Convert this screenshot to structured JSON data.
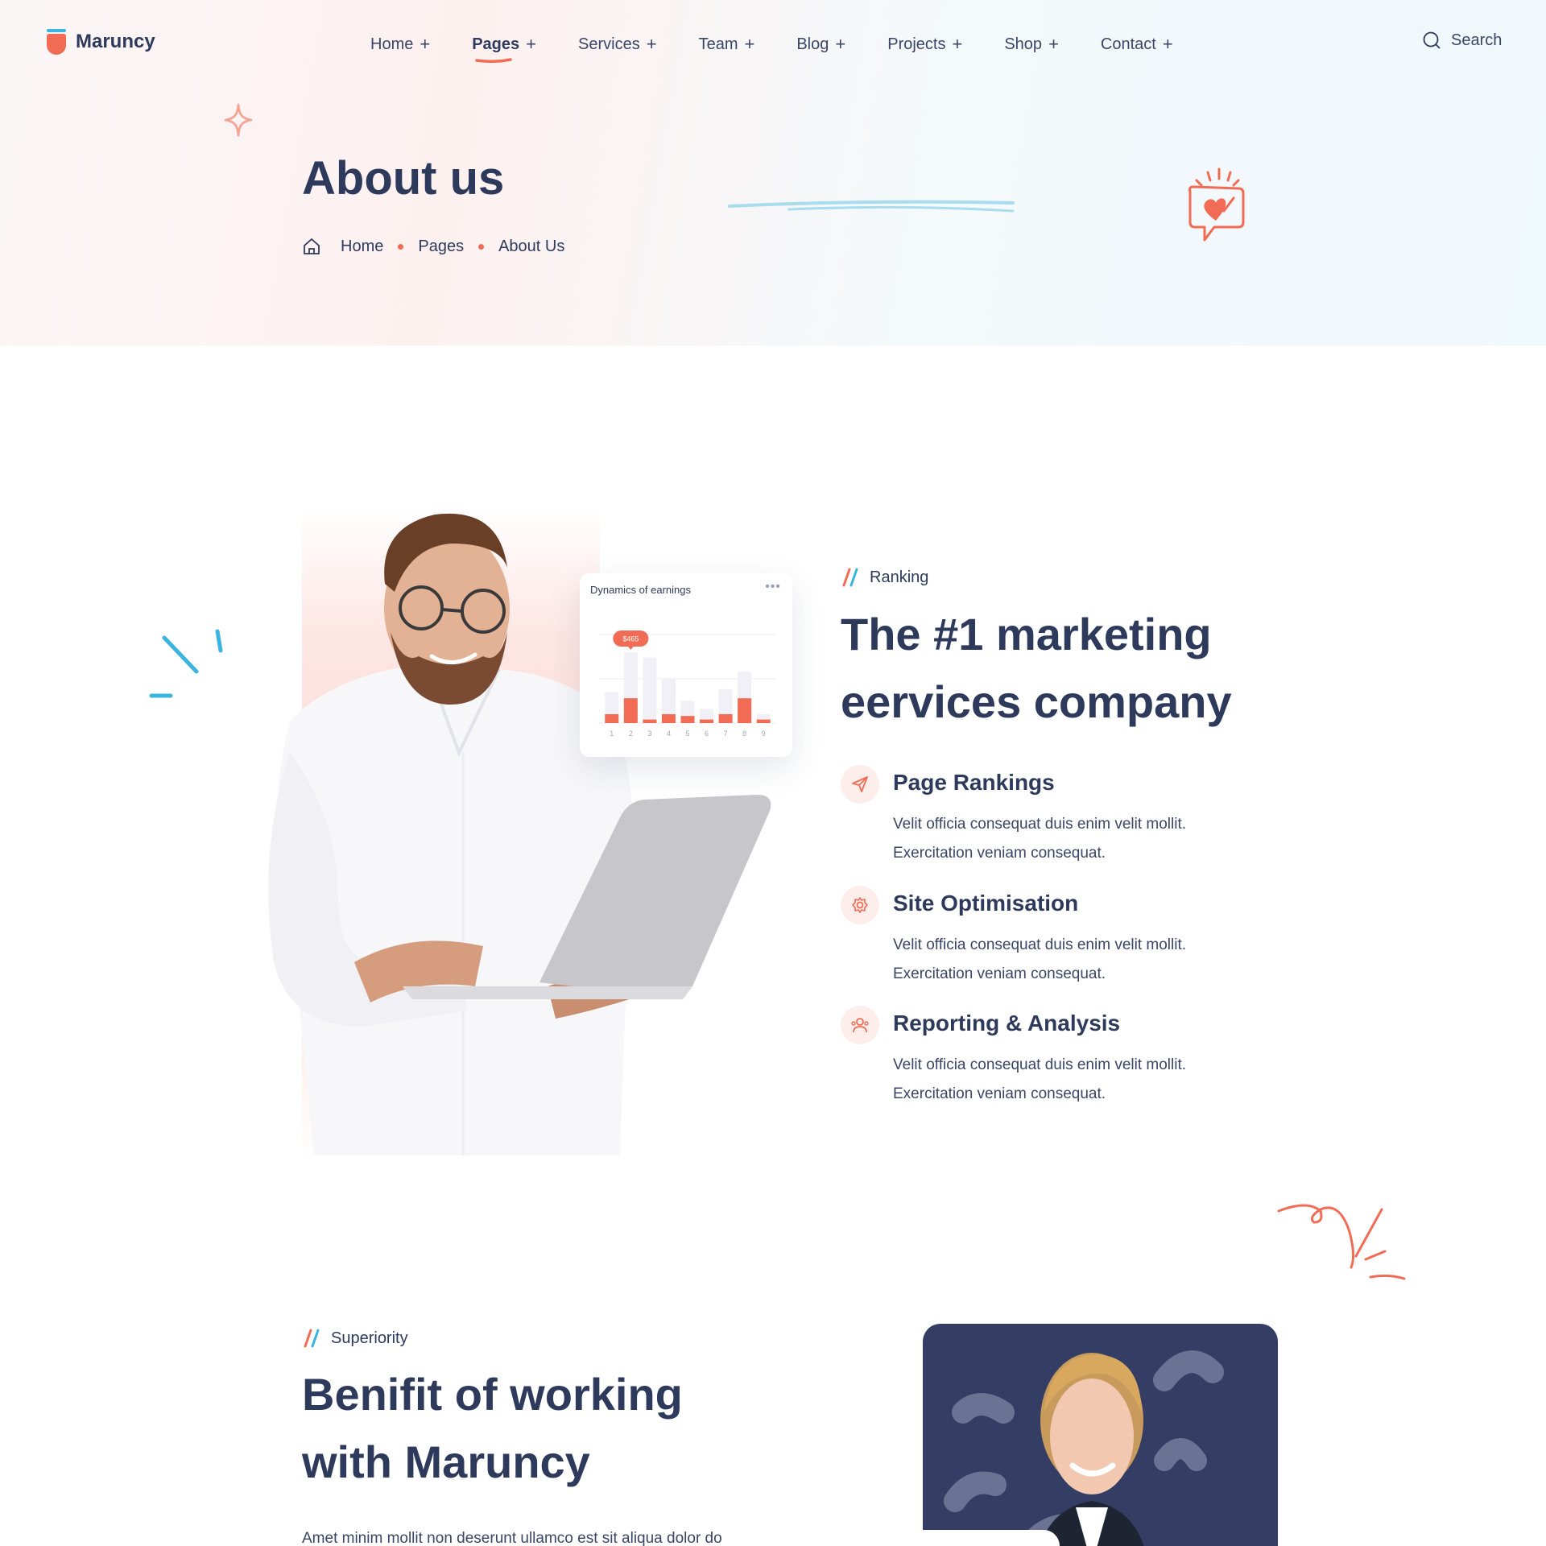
{
  "brand": {
    "name": "Maruncy",
    "accent": "#f26b54",
    "secondary": "#3bb5e0",
    "navy": "#2e3a5c"
  },
  "nav": {
    "items": [
      {
        "label": "Home"
      },
      {
        "label": "Pages",
        "active": true
      },
      {
        "label": "Services"
      },
      {
        "label": "Team"
      },
      {
        "label": "Blog"
      },
      {
        "label": "Projects"
      },
      {
        "label": "Shop"
      },
      {
        "label": "Contact"
      }
    ],
    "expand_icon": "+",
    "search_label": "Search"
  },
  "hero": {
    "title": "About us",
    "breadcrumb": [
      "Home",
      "Pages",
      "About Us"
    ]
  },
  "about": {
    "eyebrow": "Ranking",
    "heading_line1": "The #1 marketing",
    "heading_line2": "eervices company",
    "features": [
      {
        "icon": "paper-plane-icon",
        "title": "Page Rankings",
        "desc_line1": "Velit officia consequat duis enim velit mollit.",
        "desc_line2": "Exercitation veniam consequat."
      },
      {
        "icon": "gear-icon",
        "title": "Site Optimisation",
        "desc_line1": "Velit officia consequat duis enim velit mollit.",
        "desc_line2": "Exercitation veniam consequat."
      },
      {
        "icon": "users-icon",
        "title": "Reporting & Analysis",
        "desc_line1": "Velit officia consequat duis enim velit mollit.",
        "desc_line2": "Exercitation veniam consequat."
      }
    ],
    "earnings_card": {
      "title": "Dynamics of earnings",
      "menu_icon": "more-horizontal-icon",
      "tooltip": "$465"
    }
  },
  "chart_data": {
    "type": "bar",
    "title": "Dynamics of earnings",
    "categories": [
      "1",
      "2",
      "3",
      "4",
      "5",
      "6",
      "7",
      "8",
      "9"
    ],
    "series": [
      {
        "values": [
          35,
          80,
          74,
          50,
          25,
          16,
          38,
          58,
          10
        ],
        "color": "#f1f0f6"
      },
      {
        "values": [
          10,
          28,
          4,
          10,
          8,
          4,
          10,
          28,
          4
        ],
        "color": "#f26b54"
      }
    ],
    "highlight": {
      "category": "2",
      "label": "$465"
    },
    "ylim": [
      0,
      100
    ],
    "grid": true
  },
  "superiority": {
    "eyebrow": "Superiority",
    "heading_line1": "Benifit of working",
    "heading_line2": "with Maruncy",
    "paragraph": "Amet minim mollit non deserunt ullamco est sit aliqua dolor do"
  }
}
